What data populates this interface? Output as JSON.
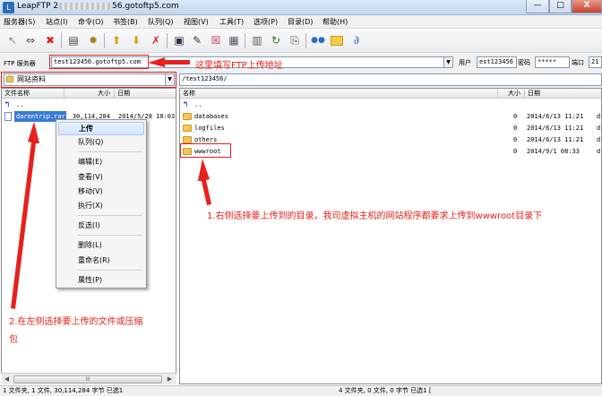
{
  "window": {
    "title_prefix": "LeapFTP 2",
    "title_suffix": "56.gotoftp5.com",
    "min_label": "—",
    "max_label": "□",
    "close_label": "X"
  },
  "menu": [
    "服务器(S)",
    "站点(I)",
    "命令(O)",
    "书签(B)",
    "队列(Q)",
    "视图(V)",
    "工具(T)",
    "选项(P)",
    "目录(D)",
    "帮助(H)"
  ],
  "server_bar": {
    "ftp_label": "FTP 服务器",
    "server_value": "test123456.gotoftp5.com",
    "user_label": "用户",
    "user_value": "est123456",
    "pass_label": "密码",
    "pass_value": "*****",
    "port_label": "端口",
    "port_value": "21"
  },
  "local": {
    "path_value": "网站资料",
    "columns": [
      "文件名称",
      "大小",
      "日期"
    ],
    "rows": [
      {
        "name": "..",
        "size": "",
        "date": ""
      },
      {
        "name": "darentrip.rar",
        "size": "30,114,284",
        "date": "2014/5/28 10:03"
      }
    ]
  },
  "remote": {
    "path_value": "/test123456/",
    "columns": [
      "名称",
      "大小",
      "日期"
    ],
    "rows": [
      {
        "name": "..",
        "size": "",
        "date": "",
        "extra": ""
      },
      {
        "name": "databases",
        "size": "0",
        "date": "2014/6/13 11:21",
        "extra": "d"
      },
      {
        "name": "logfiles",
        "size": "0",
        "date": "2014/6/13 11:21",
        "extra": "d"
      },
      {
        "name": "others",
        "size": "0",
        "date": "2014/6/13 11:21",
        "extra": "d"
      },
      {
        "name": "wwwroot",
        "size": "0",
        "date": "2014/9/1 08:33",
        "extra": "d"
      }
    ]
  },
  "context_menu": {
    "items": [
      "上传",
      "队列(Q)",
      "编辑(E)",
      "查看(V)",
      "移动(V)",
      "执行(X)",
      "反选(I)",
      "删除(L)",
      "重命名(R)",
      "属性(P)"
    ]
  },
  "status": {
    "local": "1 文件夹, 1 文件, 30,114,284 字节 已选1",
    "remote": "4 文件夹, 0 文件, 0 字节 已选1 [",
    "scroll_grip": "III"
  },
  "annotations": {
    "server_note": "这里填写FTP上传地址",
    "remote_note": "1.右侧选择要上传到的目录，我司虚拟主机的网站程序都要求上传到wwwroot目录下",
    "local_note_line1": "2.在左侧选择要上传的文件或压缩",
    "local_note_line2": "包"
  },
  "colors": {
    "annotation_red": "#e8201c",
    "selection_blue": "#3a7bd5",
    "folder_yellow": "#f3c65a"
  },
  "icons": [
    "disconnect-icon",
    "connect-icon",
    "stop-icon",
    "site-manager-icon",
    "quick-connect-icon",
    "upload-icon",
    "download-icon",
    "cancel-icon",
    "view-icon",
    "edit-icon",
    "delete-icon",
    "rename-icon",
    "properties-icon",
    "refresh-icon",
    "goto-folder-icon",
    "folder-icon",
    "link-icon"
  ]
}
